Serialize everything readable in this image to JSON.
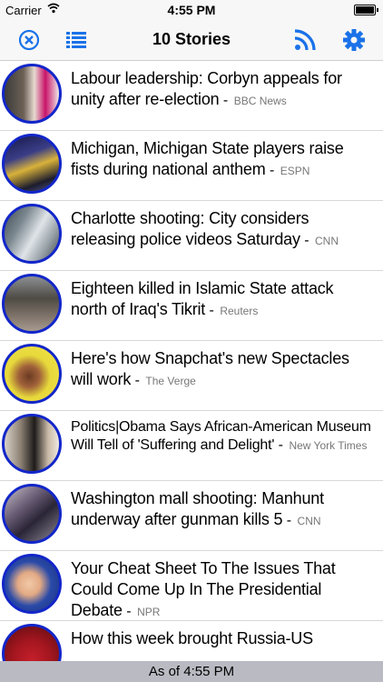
{
  "status_bar": {
    "carrier": "Carrier",
    "time": "4:55 PM"
  },
  "navbar": {
    "title": "10 Stories",
    "left_icons": [
      "close-icon",
      "list-icon"
    ],
    "right_icons": [
      "rss-icon",
      "gear-icon"
    ],
    "accent_color": "#1a72e8"
  },
  "stories": [
    {
      "headline": "Labour leadership: Corbyn appeals for unity after re-election",
      "source": "BBC News"
    },
    {
      "headline": "Michigan, Michigan State players raise fists during national anthem",
      "source": "ESPN"
    },
    {
      "headline": "Charlotte shooting: City considers releasing police videos Saturday",
      "source": "CNN"
    },
    {
      "headline": "Eighteen killed in Islamic State attack north of Iraq's Tikrit",
      "source": "Reuters"
    },
    {
      "headline": "Here's how Snapchat's new Spectacles will work",
      "source": "The Verge"
    },
    {
      "headline": "Politics|Obama Says African-American Museum Will Tell of 'Suffering and Delight'",
      "source": "New York Times"
    },
    {
      "headline": "Washington mall shooting: Manhunt underway after gunman kills 5",
      "source": "CNN"
    },
    {
      "headline": "Your Cheat Sheet To The Issues That Could Come Up In The Presidential Debate",
      "source": "NPR"
    },
    {
      "headline": "How this week brought Russia-US",
      "source": ""
    }
  ],
  "footer": {
    "text": "As of 4:55 PM"
  },
  "thumb_border_color": "#1226c9"
}
